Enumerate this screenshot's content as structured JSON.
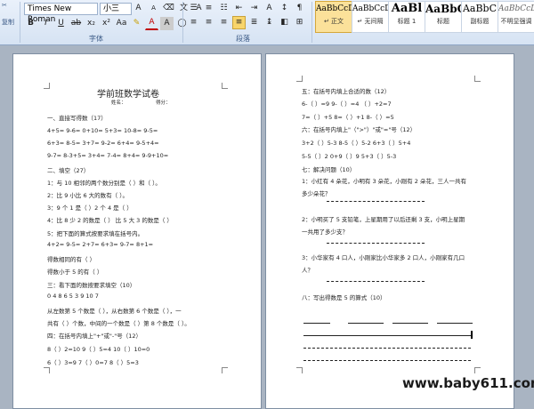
{
  "ribbon": {
    "font_name": "Times New Roman",
    "font_size": "小三",
    "group_font": "字体",
    "group_paragraph": "段落",
    "left_fragment": "复制",
    "styles": [
      {
        "preview": "AaBbCcDd",
        "name": "正文"
      },
      {
        "preview": "AaBbCcDd",
        "name": "无间隔"
      },
      {
        "preview": "AaBl",
        "name": "标题 1"
      },
      {
        "preview": "AaBbC",
        "name": "标题"
      },
      {
        "preview": "AaBbC",
        "name": "副标题"
      },
      {
        "preview": "AaBbCcDd",
        "name": "不明显强调"
      }
    ]
  },
  "left_page": {
    "title": "学前班数学试卷",
    "name_label": "姓名：",
    "score_label": "得分：",
    "lines": [
      "一、直接写得数（17）",
      "4+5=        9-6=        0+10=        5+3=        10-8=        9-5=",
      "6+3=                     8-5= 3+7=                     9-2= 6+4= 9-5+4=",
      "9-7=        8-3+5=        3+4=        7-4=        8+4=        9-9+10=",
      "二、填空（27）",
      "1：与 10 相邻的两个数分别是（        ）和（        ）。",
      "2：比 9 小比 6 大的数有（                ）。",
      "3：9 个 1 是（        ）2 个 4 是（        ）",
      "4：比 8 少 2 的数是（        ）  比 5 大 3 的数是（        ）",
      "5：把下面的算式按要求填在括号内。",
      "4+2=        9-5=        2+7=        6+3=        9-7=        8+1=",
      "得数相同的有（                        ）",
      "得数小于 5 的有（                        ）",
      "三：看下面的数按要求填空（10）",
      "0      4      8      6      5      3      9      10      7",
      "从左数第 5 个数是（        ），从右数第 6 个数是（        ），一",
      "共有（        ）个数，中间的一个数是（        ）第 8 个数是（        ）。",
      "四：在括号内填上\"+\"或\"-\"号（12）",
      "8（    ）2=10              9（    ）5=4              10（    ）10=0",
      "6（    ）3=9              7（    ）0=7              8（    ）5=3"
    ]
  },
  "right_page": {
    "lines": [
      "五：在括号内填上合适的数（12）",
      "6-（    ）=9          9-（    ）=4          （    ）+2=7",
      "7=（    ）+5          8=（    ）+1          8-（    ）=5",
      "六：在括号内填上\"（\">\"）\"或\"=\"号（12）",
      "3+2（    ）5-3          8-5（    ）5-2          6+3（    ）5+4",
      "5-5（    ）2          0+9（    ）9          5+3（    ）5-3",
      "七：解决问题（10）",
      "1：小红有 4 朵花，小明有 3 朵花，小刚有 2 朵花，三人一共有",
      "多少朵花？",
      "2：小明买了 5 支铅笔，上星期用了以后还剩 3 支，小明上星期",
      "一共用了多少支？",
      "3：小华家有 4 口人，小刚家比小华家多 2 口人，小刚家有几口",
      "人？",
      "八：写出得数是 5 的算式（10）"
    ]
  },
  "watermark": "www.baby611.com"
}
